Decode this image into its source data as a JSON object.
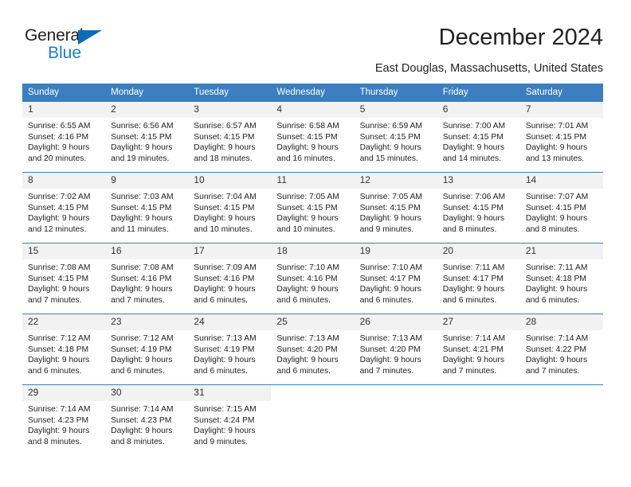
{
  "brand": {
    "name_top": "General",
    "name_bottom": "Blue"
  },
  "header": {
    "title": "December 2024",
    "location": "East Douglas, Massachusetts, United States"
  },
  "colors": {
    "header_blue": "#3c7ebf",
    "logo_blue": "#1b7dc4",
    "daynum_band": "#f2f2f2",
    "text": "#222222"
  },
  "weekday_headers": [
    "Sunday",
    "Monday",
    "Tuesday",
    "Wednesday",
    "Thursday",
    "Friday",
    "Saturday"
  ],
  "weeks": [
    [
      {
        "day": "1",
        "sunrise": "Sunrise: 6:55 AM",
        "sunset": "Sunset: 4:16 PM",
        "daylight1": "Daylight: 9 hours",
        "daylight2": "and 20 minutes."
      },
      {
        "day": "2",
        "sunrise": "Sunrise: 6:56 AM",
        "sunset": "Sunset: 4:15 PM",
        "daylight1": "Daylight: 9 hours",
        "daylight2": "and 19 minutes."
      },
      {
        "day": "3",
        "sunrise": "Sunrise: 6:57 AM",
        "sunset": "Sunset: 4:15 PM",
        "daylight1": "Daylight: 9 hours",
        "daylight2": "and 18 minutes."
      },
      {
        "day": "4",
        "sunrise": "Sunrise: 6:58 AM",
        "sunset": "Sunset: 4:15 PM",
        "daylight1": "Daylight: 9 hours",
        "daylight2": "and 16 minutes."
      },
      {
        "day": "5",
        "sunrise": "Sunrise: 6:59 AM",
        "sunset": "Sunset: 4:15 PM",
        "daylight1": "Daylight: 9 hours",
        "daylight2": "and 15 minutes."
      },
      {
        "day": "6",
        "sunrise": "Sunrise: 7:00 AM",
        "sunset": "Sunset: 4:15 PM",
        "daylight1": "Daylight: 9 hours",
        "daylight2": "and 14 minutes."
      },
      {
        "day": "7",
        "sunrise": "Sunrise: 7:01 AM",
        "sunset": "Sunset: 4:15 PM",
        "daylight1": "Daylight: 9 hours",
        "daylight2": "and 13 minutes."
      }
    ],
    [
      {
        "day": "8",
        "sunrise": "Sunrise: 7:02 AM",
        "sunset": "Sunset: 4:15 PM",
        "daylight1": "Daylight: 9 hours",
        "daylight2": "and 12 minutes."
      },
      {
        "day": "9",
        "sunrise": "Sunrise: 7:03 AM",
        "sunset": "Sunset: 4:15 PM",
        "daylight1": "Daylight: 9 hours",
        "daylight2": "and 11 minutes."
      },
      {
        "day": "10",
        "sunrise": "Sunrise: 7:04 AM",
        "sunset": "Sunset: 4:15 PM",
        "daylight1": "Daylight: 9 hours",
        "daylight2": "and 10 minutes."
      },
      {
        "day": "11",
        "sunrise": "Sunrise: 7:05 AM",
        "sunset": "Sunset: 4:15 PM",
        "daylight1": "Daylight: 9 hours",
        "daylight2": "and 10 minutes."
      },
      {
        "day": "12",
        "sunrise": "Sunrise: 7:05 AM",
        "sunset": "Sunset: 4:15 PM",
        "daylight1": "Daylight: 9 hours",
        "daylight2": "and 9 minutes."
      },
      {
        "day": "13",
        "sunrise": "Sunrise: 7:06 AM",
        "sunset": "Sunset: 4:15 PM",
        "daylight1": "Daylight: 9 hours",
        "daylight2": "and 8 minutes."
      },
      {
        "day": "14",
        "sunrise": "Sunrise: 7:07 AM",
        "sunset": "Sunset: 4:15 PM",
        "daylight1": "Daylight: 9 hours",
        "daylight2": "and 8 minutes."
      }
    ],
    [
      {
        "day": "15",
        "sunrise": "Sunrise: 7:08 AM",
        "sunset": "Sunset: 4:15 PM",
        "daylight1": "Daylight: 9 hours",
        "daylight2": "and 7 minutes."
      },
      {
        "day": "16",
        "sunrise": "Sunrise: 7:08 AM",
        "sunset": "Sunset: 4:16 PM",
        "daylight1": "Daylight: 9 hours",
        "daylight2": "and 7 minutes."
      },
      {
        "day": "17",
        "sunrise": "Sunrise: 7:09 AM",
        "sunset": "Sunset: 4:16 PM",
        "daylight1": "Daylight: 9 hours",
        "daylight2": "and 6 minutes."
      },
      {
        "day": "18",
        "sunrise": "Sunrise: 7:10 AM",
        "sunset": "Sunset: 4:16 PM",
        "daylight1": "Daylight: 9 hours",
        "daylight2": "and 6 minutes."
      },
      {
        "day": "19",
        "sunrise": "Sunrise: 7:10 AM",
        "sunset": "Sunset: 4:17 PM",
        "daylight1": "Daylight: 9 hours",
        "daylight2": "and 6 minutes."
      },
      {
        "day": "20",
        "sunrise": "Sunrise: 7:11 AM",
        "sunset": "Sunset: 4:17 PM",
        "daylight1": "Daylight: 9 hours",
        "daylight2": "and 6 minutes."
      },
      {
        "day": "21",
        "sunrise": "Sunrise: 7:11 AM",
        "sunset": "Sunset: 4:18 PM",
        "daylight1": "Daylight: 9 hours",
        "daylight2": "and 6 minutes."
      }
    ],
    [
      {
        "day": "22",
        "sunrise": "Sunrise: 7:12 AM",
        "sunset": "Sunset: 4:18 PM",
        "daylight1": "Daylight: 9 hours",
        "daylight2": "and 6 minutes."
      },
      {
        "day": "23",
        "sunrise": "Sunrise: 7:12 AM",
        "sunset": "Sunset: 4:19 PM",
        "daylight1": "Daylight: 9 hours",
        "daylight2": "and 6 minutes."
      },
      {
        "day": "24",
        "sunrise": "Sunrise: 7:13 AM",
        "sunset": "Sunset: 4:19 PM",
        "daylight1": "Daylight: 9 hours",
        "daylight2": "and 6 minutes."
      },
      {
        "day": "25",
        "sunrise": "Sunrise: 7:13 AM",
        "sunset": "Sunset: 4:20 PM",
        "daylight1": "Daylight: 9 hours",
        "daylight2": "and 6 minutes."
      },
      {
        "day": "26",
        "sunrise": "Sunrise: 7:13 AM",
        "sunset": "Sunset: 4:20 PM",
        "daylight1": "Daylight: 9 hours",
        "daylight2": "and 7 minutes."
      },
      {
        "day": "27",
        "sunrise": "Sunrise: 7:14 AM",
        "sunset": "Sunset: 4:21 PM",
        "daylight1": "Daylight: 9 hours",
        "daylight2": "and 7 minutes."
      },
      {
        "day": "28",
        "sunrise": "Sunrise: 7:14 AM",
        "sunset": "Sunset: 4:22 PM",
        "daylight1": "Daylight: 9 hours",
        "daylight2": "and 7 minutes."
      }
    ],
    [
      {
        "day": "29",
        "sunrise": "Sunrise: 7:14 AM",
        "sunset": "Sunset: 4:23 PM",
        "daylight1": "Daylight: 9 hours",
        "daylight2": "and 8 minutes."
      },
      {
        "day": "30",
        "sunrise": "Sunrise: 7:14 AM",
        "sunset": "Sunset: 4:23 PM",
        "daylight1": "Daylight: 9 hours",
        "daylight2": "and 8 minutes."
      },
      {
        "day": "31",
        "sunrise": "Sunrise: 7:15 AM",
        "sunset": "Sunset: 4:24 PM",
        "daylight1": "Daylight: 9 hours",
        "daylight2": "and 9 minutes."
      },
      {
        "day": "",
        "sunrise": "",
        "sunset": "",
        "daylight1": "",
        "daylight2": ""
      },
      {
        "day": "",
        "sunrise": "",
        "sunset": "",
        "daylight1": "",
        "daylight2": ""
      },
      {
        "day": "",
        "sunrise": "",
        "sunset": "",
        "daylight1": "",
        "daylight2": ""
      },
      {
        "day": "",
        "sunrise": "",
        "sunset": "",
        "daylight1": "",
        "daylight2": ""
      }
    ]
  ]
}
